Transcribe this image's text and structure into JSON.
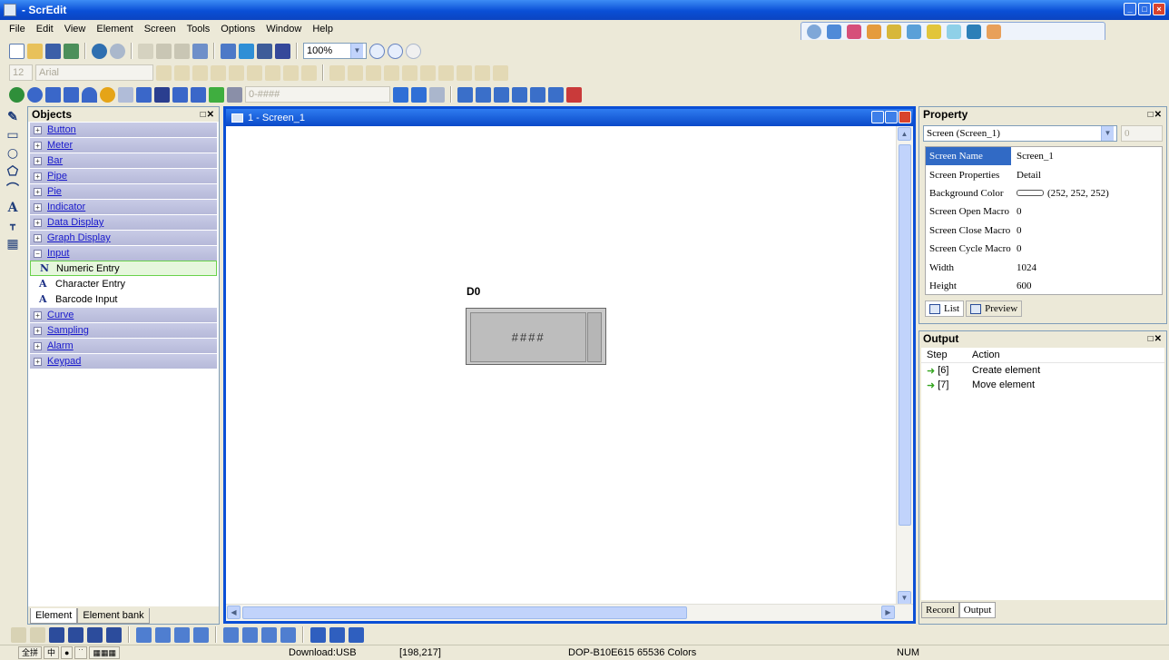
{
  "app": {
    "title": "- ScrEdit"
  },
  "menu": [
    {
      "label": "File"
    },
    {
      "label": "Edit"
    },
    {
      "label": "View"
    },
    {
      "label": "Element"
    },
    {
      "label": "Screen"
    },
    {
      "label": "Tools"
    },
    {
      "label": "Options"
    },
    {
      "label": "Window"
    },
    {
      "label": "Help"
    }
  ],
  "toolbar": {
    "zoom_value": "100%",
    "font_size": "12",
    "font_name": "Arial",
    "format_value": "0-####"
  },
  "objects_panel": {
    "title": "Objects",
    "categories": [
      {
        "label": "Button"
      },
      {
        "label": "Meter"
      },
      {
        "label": "Bar"
      },
      {
        "label": "Pipe"
      },
      {
        "label": "Pie"
      },
      {
        "label": "Indicator"
      },
      {
        "label": "Data Display"
      },
      {
        "label": "Graph Display"
      },
      {
        "label": "Input"
      }
    ],
    "input_items": [
      {
        "label": "Numeric Entry",
        "icon": "N"
      },
      {
        "label": "Character Entry",
        "icon": "A"
      },
      {
        "label": "Barcode Input",
        "icon": "A"
      }
    ],
    "categories_after": [
      {
        "label": "Curve"
      },
      {
        "label": "Sampling"
      },
      {
        "label": "Alarm"
      },
      {
        "label": "Keypad"
      }
    ],
    "tabs": [
      "Element",
      "Element bank"
    ]
  },
  "screen_window": {
    "title": "1 - Screen_1",
    "element": {
      "label": "D0",
      "value": "####"
    }
  },
  "property_panel": {
    "title": "Property",
    "selector": "Screen (Screen_1)",
    "selector_num": "0",
    "rows": [
      {
        "key": "Screen Name",
        "value": "Screen_1"
      },
      {
        "key": "Screen Properties",
        "value": "Detail"
      },
      {
        "key": "Background Color",
        "value": "(252, 252, 252)"
      },
      {
        "key": "Screen Open Macro",
        "value": "0"
      },
      {
        "key": "Screen Close Macro",
        "value": "0"
      },
      {
        "key": "Screen Cycle Macro",
        "value": "0"
      },
      {
        "key": "Width",
        "value": "1024"
      },
      {
        "key": "Height",
        "value": "600"
      }
    ],
    "tabs": [
      "List",
      "Preview"
    ]
  },
  "output_panel": {
    "title": "Output",
    "col_step": "Step",
    "col_action": "Action",
    "rows": [
      {
        "step": "[6]",
        "action": "Create element"
      },
      {
        "step": "[7]",
        "action": "Move element"
      }
    ],
    "tabs": [
      "Record",
      "Output"
    ]
  },
  "status": {
    "download": "Download:USB",
    "coords": "[198,217]",
    "device": "DOP-B10E615 65536 Colors",
    "num": "NUM",
    "ime": [
      "全拼",
      "中",
      "●",
      "˙˙",
      "▦▦▦"
    ]
  },
  "colors": {
    "titlebar": "#0a4fd6",
    "category_bg": "#c8cbe6",
    "selected_green": "#69d24b"
  }
}
